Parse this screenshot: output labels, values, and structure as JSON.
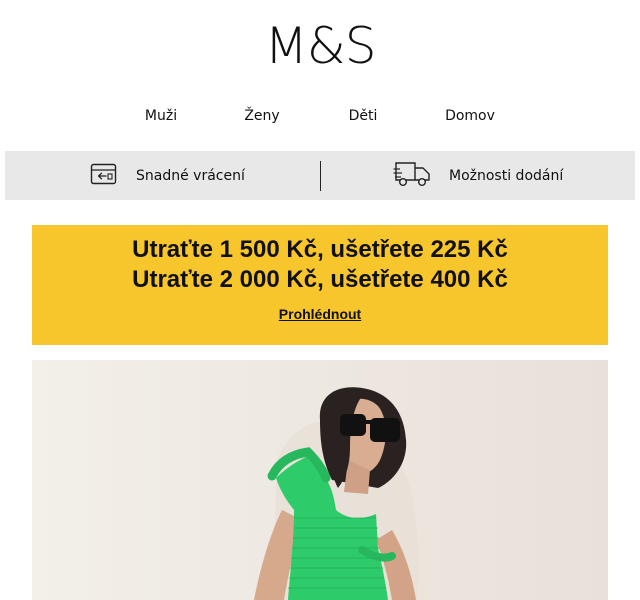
{
  "brand": {
    "logo_text": "M&S"
  },
  "nav": {
    "items": [
      {
        "label": "Muži"
      },
      {
        "label": "Ženy"
      },
      {
        "label": "Děti"
      },
      {
        "label": "Domov"
      }
    ]
  },
  "services": {
    "returns": {
      "label": "Snadné vrácení",
      "icon": "return-package-icon"
    },
    "delivery": {
      "label": "Možnosti dodání",
      "icon": "delivery-truck-icon"
    }
  },
  "promo": {
    "line1": "Utraťte 1 500 Kč, ušetřete 225 Kč",
    "line2": "Utraťte 2 000 Kč, ušetřete 400 Kč",
    "cta_label": "Prohlédnout",
    "background_color": "#f7c52c"
  },
  "hero": {
    "description": "Model in green smocked dress with black sunglasses",
    "dress_color": "#2ecb6a"
  }
}
